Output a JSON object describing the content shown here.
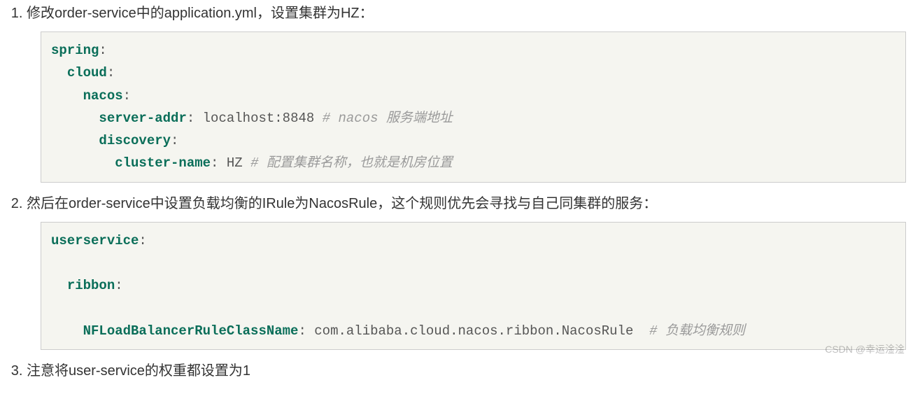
{
  "steps": [
    {
      "text": "修改order-service中的application.yml，设置集群为HZ：",
      "code": {
        "lines": [
          {
            "key": "spring",
            "colon": ":"
          },
          {
            "indent": 1,
            "key": "cloud",
            "colon": ":"
          },
          {
            "indent": 2,
            "key": "nacos",
            "colon": ":"
          },
          {
            "indent": 3,
            "key": "server-addr",
            "colon": ": ",
            "val": "localhost:8848",
            "comment": " # nacos 服务端地址"
          },
          {
            "indent": 3,
            "key": "discovery",
            "colon": ":"
          },
          {
            "indent": 4,
            "key": "cluster-name",
            "colon": ": ",
            "val": "HZ",
            "comment": " # 配置集群名称，也就是机房位置"
          }
        ]
      }
    },
    {
      "text": "然后在order-service中设置负载均衡的IRule为NacosRule，这个规则优先会寻找与自己同集群的服务：",
      "code": {
        "lines": [
          {
            "key": "userservice",
            "colon": ":"
          },
          {
            "blank": true
          },
          {
            "indent": 1,
            "key": "ribbon",
            "colon": ":"
          },
          {
            "blank": true
          },
          {
            "indent": 2,
            "key": "NFLoadBalancerRuleClassName",
            "colon": ": ",
            "val": "com.alibaba.cloud.nacos.ribbon.NacosRule",
            "comment": "  # 负载均衡规则",
            "cursor": true
          }
        ]
      }
    },
    {
      "text": "注意将user-service的权重都设置为1"
    }
  ],
  "watermark": "CSDN @幸运淦淦"
}
